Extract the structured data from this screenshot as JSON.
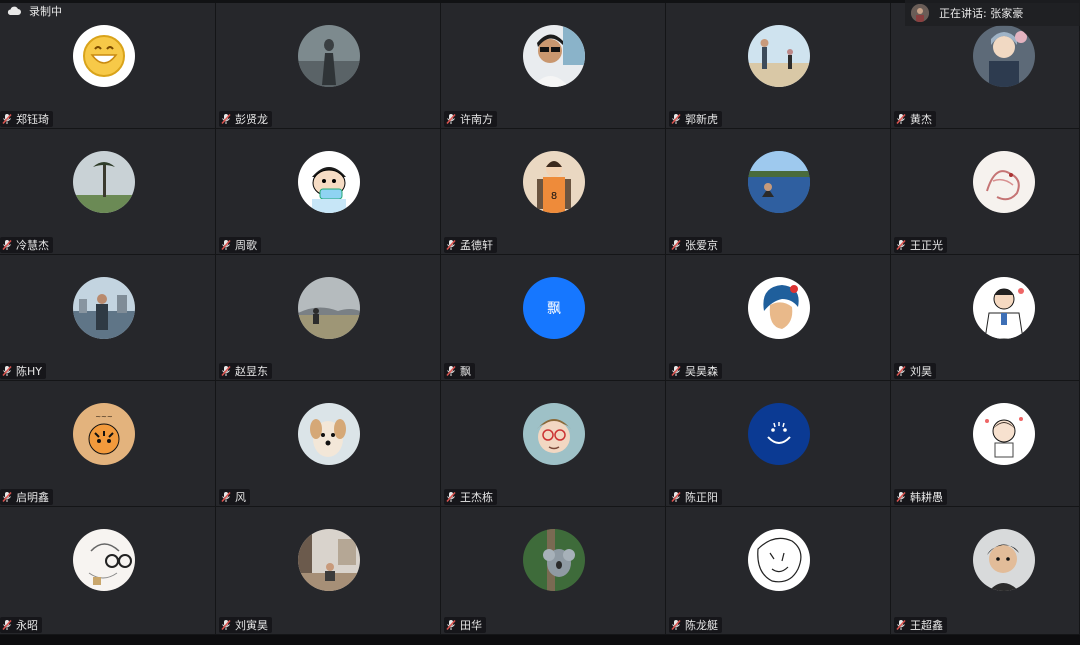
{
  "recording": {
    "label": "录制中",
    "icon": "cloud-icon"
  },
  "speaking": {
    "label": "正在讲话: 张家豪"
  },
  "participants": [
    {
      "name": "郑钰琦",
      "avatar": "smiley"
    },
    {
      "name": "彭贤龙",
      "avatar": "photo-gray"
    },
    {
      "name": "许南方",
      "avatar": "photo-man"
    },
    {
      "name": "郭新虎",
      "avatar": "photo-beach"
    },
    {
      "name": "黄杰",
      "avatar": "photo-anime"
    },
    {
      "name": "冷慧杰",
      "avatar": "photo-tree"
    },
    {
      "name": "周歌",
      "avatar": "cartoon-boy"
    },
    {
      "name": "孟德轩",
      "avatar": "anime-player"
    },
    {
      "name": "张爱京",
      "avatar": "photo-lake"
    },
    {
      "name": "王正光",
      "avatar": "sketch-dragon"
    },
    {
      "name": "陈HY",
      "avatar": "photo-city"
    },
    {
      "name": "赵昱东",
      "avatar": "photo-field"
    },
    {
      "name": "飘",
      "avatar": "letter",
      "letter": "飘",
      "color": "#1677ff"
    },
    {
      "name": "吴昊森",
      "avatar": "illustration-face"
    },
    {
      "name": "刘昊",
      "avatar": "cartoon-doctor"
    },
    {
      "name": "启明鑫",
      "avatar": "tiger"
    },
    {
      "name": "风",
      "avatar": "puppy"
    },
    {
      "name": "王杰栋",
      "avatar": "cartoon-glasses"
    },
    {
      "name": "陈正阳",
      "avatar": "blue-smile"
    },
    {
      "name": "韩耕愚",
      "avatar": "chibi"
    },
    {
      "name": "永昭",
      "avatar": "sketch-glasses"
    },
    {
      "name": "刘寅昊",
      "avatar": "photo-room"
    },
    {
      "name": "田华",
      "avatar": "photo-koala"
    },
    {
      "name": "陈龙艇",
      "avatar": "line-sketch"
    },
    {
      "name": "王超鑫",
      "avatar": "photo-boy"
    }
  ],
  "colors": {
    "tile": "#26272b",
    "border": "#141517",
    "mic": "#d9534f"
  }
}
